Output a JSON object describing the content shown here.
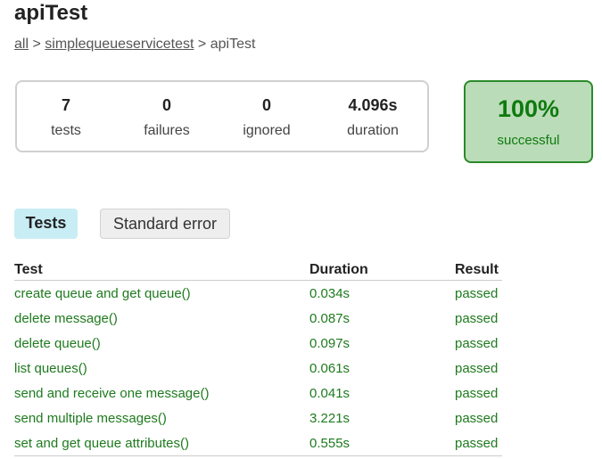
{
  "page": {
    "title": "apiTest",
    "breadcrumb": {
      "links": [
        "all",
        "simplequeueservicetest"
      ],
      "separator": ">",
      "current": "apiTest"
    }
  },
  "summary": {
    "counters": [
      {
        "value": "7",
        "label": "tests"
      },
      {
        "value": "0",
        "label": "failures"
      },
      {
        "value": "0",
        "label": "ignored"
      },
      {
        "value": "4.096s",
        "label": "duration"
      }
    ],
    "success_rate": "100%",
    "success_label": "successful"
  },
  "tabs": [
    {
      "label": "Tests",
      "active": true
    },
    {
      "label": "Standard error",
      "active": false
    }
  ],
  "table": {
    "headers": [
      "Test",
      "Duration",
      "Result"
    ],
    "rows": [
      {
        "test": "create queue and get queue()",
        "duration": "0.034s",
        "result": "passed"
      },
      {
        "test": "delete message()",
        "duration": "0.087s",
        "result": "passed"
      },
      {
        "test": "delete queue()",
        "duration": "0.097s",
        "result": "passed"
      },
      {
        "test": "list queues()",
        "duration": "0.061s",
        "result": "passed"
      },
      {
        "test": "send and receive one message()",
        "duration": "0.041s",
        "result": "passed"
      },
      {
        "test": "send multiple messages()",
        "duration": "3.221s",
        "result": "passed"
      },
      {
        "test": "set and get queue attributes()",
        "duration": "0.555s",
        "result": "passed"
      }
    ]
  },
  "colors": {
    "success_green": "#0f7a0f",
    "success_background": "#bbdcb9",
    "active_tab": "#c9edf4",
    "passed_text": "#1e7a1e"
  }
}
